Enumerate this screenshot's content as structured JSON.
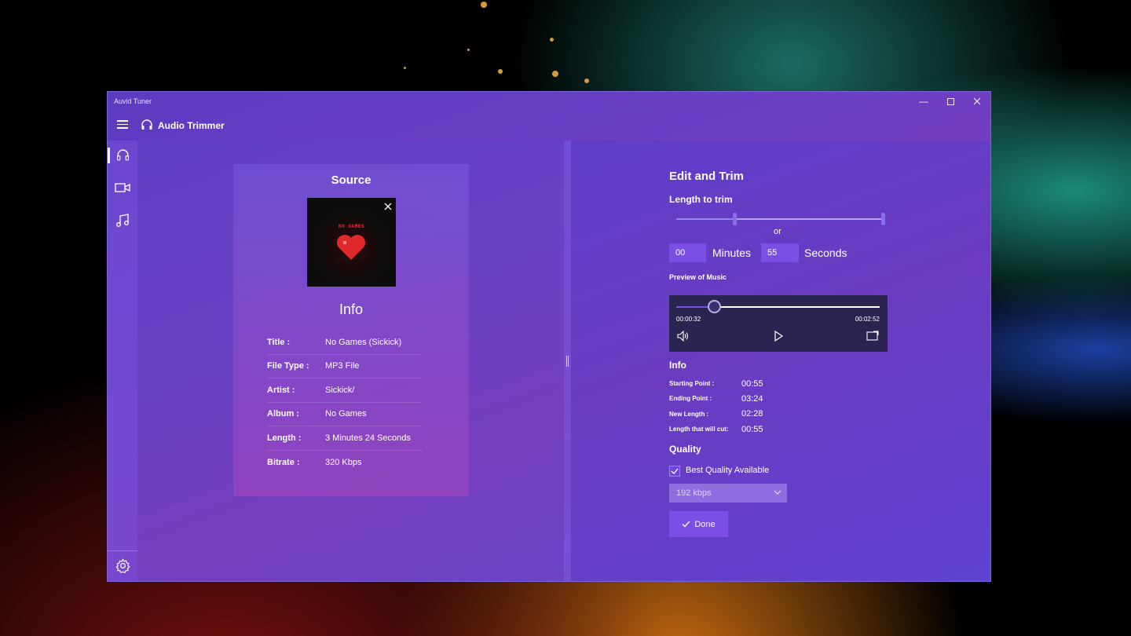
{
  "window": {
    "app_title": "Auvid Tuner"
  },
  "header": {
    "title": "Audio Trimmer"
  },
  "source_card": {
    "title": "Source",
    "album_art_text": "NO GAMES",
    "info_heading": "Info",
    "info_rows": [
      {
        "key": "Title :",
        "value": "No Games (Sickick)"
      },
      {
        "key": "File Type :",
        "value": "MP3 File"
      },
      {
        "key": "Artist :",
        "value": "Sickick/"
      },
      {
        "key": "Album :",
        "value": "No Games"
      },
      {
        "key": "Length :",
        "value": "3 Minutes 24 Seconds"
      },
      {
        "key": "Bitrate :",
        "value": "320 Kbps"
      }
    ]
  },
  "edit": {
    "title": "Edit and Trim",
    "length_label": "Length to trim",
    "or_label": "or",
    "minutes_value": "00",
    "minutes_label": "Minutes",
    "seconds_value": "55",
    "seconds_label": "Seconds",
    "preview_label": "Preview of Music",
    "player": {
      "current_time": "00:00:32",
      "total_time": "00:02:52"
    },
    "info_title": "Info",
    "stats": [
      {
        "key": "Starting Point :",
        "value": "00:55"
      },
      {
        "key": "Ending Point :",
        "value": "03:24"
      },
      {
        "key": "New Length  :",
        "value": "02:28"
      },
      {
        "key": "Length that will cut:",
        "value": "00:55"
      }
    ],
    "quality_title": "Quality",
    "best_quality_label": "Best Quality Available",
    "bitrate_option": "192 kbps",
    "done_label": "Done"
  },
  "colors": {
    "accent": "#7b4fe6",
    "player_bg": "#2a2450"
  },
  "icons": [
    "hamburger-icon",
    "headphones-icon",
    "video-icon",
    "music-note-icon",
    "gear-icon",
    "close-icon",
    "maximize-icon",
    "minimize-icon",
    "volume-icon",
    "play-icon",
    "mini-view-icon",
    "checkmark-icon",
    "chevron-down-icon"
  ]
}
